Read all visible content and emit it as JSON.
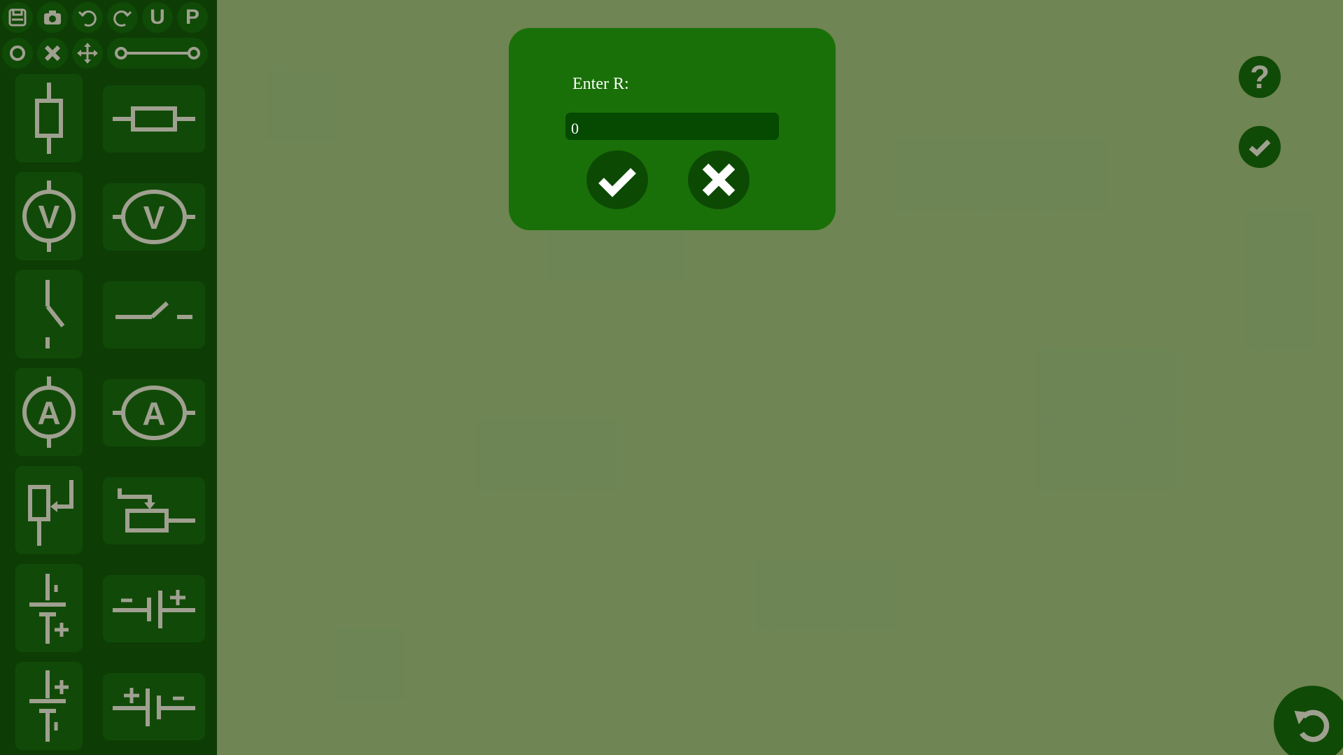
{
  "toolbar": {
    "icons": [
      "save-icon",
      "camera-icon",
      "undo-icon",
      "redo-icon",
      "u-icon",
      "p-icon",
      "circle-icon",
      "close-icon",
      "move-icon",
      "wire-icon"
    ],
    "u_label": "U",
    "p_label": "P"
  },
  "components": [
    "resistor",
    "voltmeter",
    "switch",
    "ammeter",
    "rheostat",
    "battery-plus-bottom",
    "battery-plus-top"
  ],
  "dialog": {
    "label": "Enter R:",
    "input_value": "0",
    "ok_icon": "check-icon",
    "cancel_icon": "x-icon"
  },
  "right_controls": {
    "help_label": "?",
    "check_icon": "check-icon",
    "reset_icon": "rotate-left-icon"
  },
  "meter_labels": {
    "voltmeter": "V",
    "ammeter": "A"
  },
  "colors": {
    "canvas": "#6f8553",
    "sidebar": "#0d3d04",
    "dialog": "#1a7008",
    "input": "#054a00",
    "icon_gray": "#a0a090"
  }
}
